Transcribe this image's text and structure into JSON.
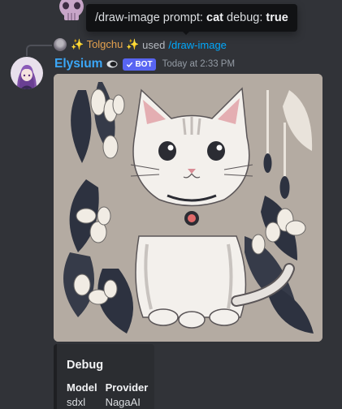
{
  "tooltip": {
    "prefix": "/draw-image prompt:",
    "prompt_value": "cat",
    "debug_label": "debug:",
    "debug_value": "true"
  },
  "reply": {
    "user": "✨ Tolgchu ✨",
    "used_text": "used",
    "command": "/draw-image"
  },
  "message": {
    "username": "Elysium",
    "bot_tag": "BOT",
    "timestamp": "Today at 2:33 PM"
  },
  "embed": {
    "title": "Debug",
    "fields": [
      {
        "name": "Model",
        "value": "sdxl"
      },
      {
        "name": "Provider",
        "value": "NagaAI"
      }
    ]
  },
  "colors": {
    "background": "#313338",
    "username": "#3ba7f7",
    "command_link": "#00a8fc",
    "reply_user": "#e3a04e",
    "bot_tag": "#5865f2"
  },
  "icons": {
    "previous_reaction": "skull-emoji-icon",
    "status": "status-icon",
    "bot_check": "checkmark-icon"
  }
}
